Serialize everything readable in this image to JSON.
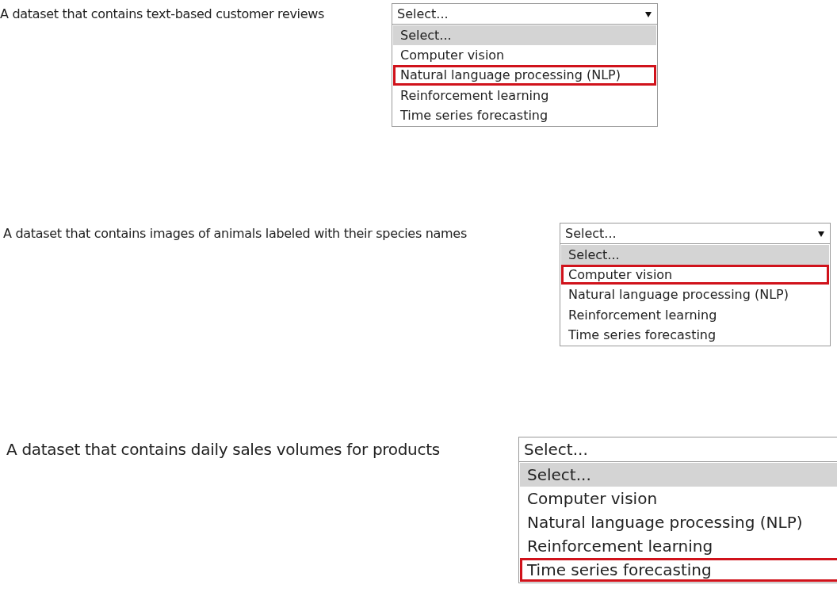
{
  "questions": [
    {
      "prompt": "A dataset that contains text-based customer reviews",
      "select": {
        "value": "Select..."
      },
      "options": [
        {
          "label": "Select...",
          "highlighted": true,
          "marked": false
        },
        {
          "label": "Computer vision",
          "highlighted": false,
          "marked": false
        },
        {
          "label": "Natural language processing (NLP)",
          "highlighted": false,
          "marked": true
        },
        {
          "label": "Reinforcement learning",
          "highlighted": false,
          "marked": false
        },
        {
          "label": "Time series forecasting",
          "highlighted": false,
          "marked": false
        }
      ]
    },
    {
      "prompt": "A dataset that contains images of animals labeled with their species names",
      "select": {
        "value": "Select..."
      },
      "options": [
        {
          "label": "Select...",
          "highlighted": true,
          "marked": false
        },
        {
          "label": "Computer vision",
          "highlighted": false,
          "marked": true
        },
        {
          "label": "Natural language processing (NLP)",
          "highlighted": false,
          "marked": false
        },
        {
          "label": "Reinforcement learning",
          "highlighted": false,
          "marked": false
        },
        {
          "label": "Time series forecasting",
          "highlighted": false,
          "marked": false
        }
      ]
    },
    {
      "prompt": "A dataset that contains daily sales volumes for products",
      "select": {
        "value": "Select..."
      },
      "options": [
        {
          "label": "Select...",
          "highlighted": true,
          "marked": false
        },
        {
          "label": "Computer vision",
          "highlighted": false,
          "marked": false
        },
        {
          "label": "Natural language processing (NLP)",
          "highlighted": false,
          "marked": false
        },
        {
          "label": "Reinforcement learning",
          "highlighted": false,
          "marked": false
        },
        {
          "label": "Time series forecasting",
          "highlighted": false,
          "marked": true
        }
      ]
    }
  ]
}
